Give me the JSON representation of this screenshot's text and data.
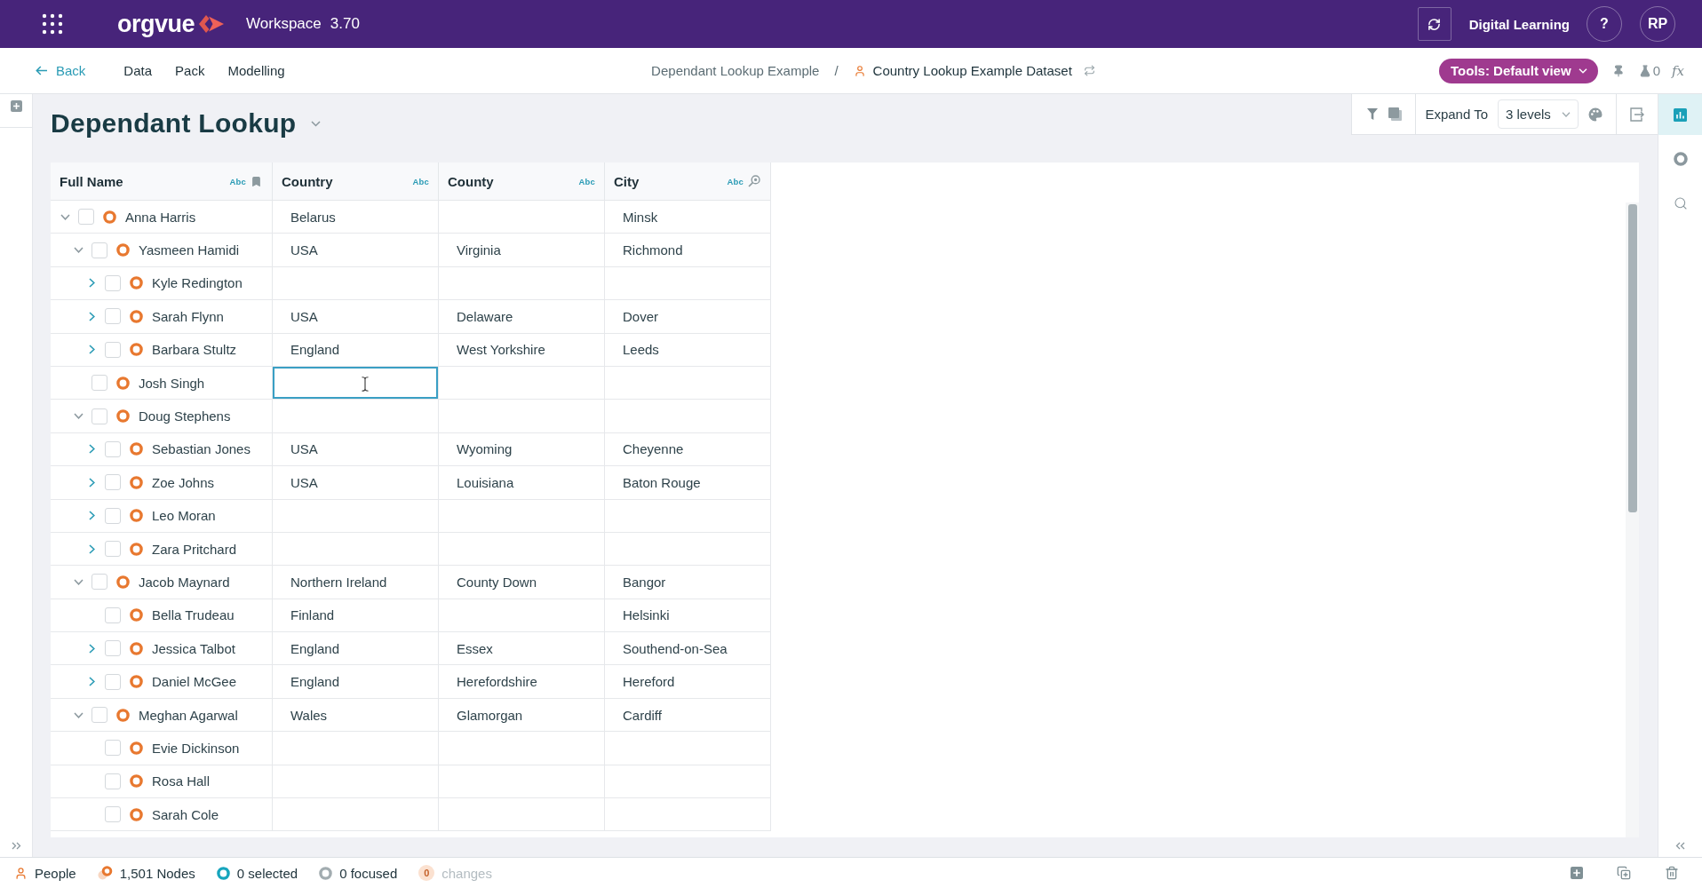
{
  "top_bar": {
    "brand": "orgvue",
    "app_name": "Workspace",
    "version": "3.70",
    "account": "Digital Learning",
    "help": "?",
    "avatar": "RP"
  },
  "nav_bar": {
    "back": "Back",
    "menu": [
      "Data",
      "Pack",
      "Modelling"
    ],
    "breadcrumb": {
      "project": "Dependant Lookup Example",
      "separator": "/",
      "dataset": "Country Lookup Example Dataset"
    },
    "tools_button": "Tools: Default view",
    "flask_count": "0",
    "formula": "fx"
  },
  "page": {
    "title": "Dependant Lookup"
  },
  "toolbar": {
    "expand_label": "Expand To",
    "expand_value": "3 levels"
  },
  "side_tabs": [
    {
      "kind": "chart",
      "selected": true
    },
    {
      "kind": "ring",
      "selected": false
    },
    {
      "kind": "search",
      "selected": false
    }
  ],
  "table": {
    "columns": [
      {
        "label": "Full Name",
        "type_label": "Abc",
        "kind": "key"
      },
      {
        "label": "Country",
        "type_label": "Abc",
        "kind": "text"
      },
      {
        "label": "County",
        "type_label": "Abc",
        "kind": "text"
      },
      {
        "label": "City",
        "type_label": "Abc",
        "kind": "lookup"
      }
    ],
    "rows": [
      {
        "kind": "branch",
        "expanded": true,
        "checked": false,
        "cells": [
          {
            "text": "Anna Harris",
            "selected": false
          },
          {
            "text": "Belarus",
            "selected": false
          },
          {
            "selected": false
          },
          {
            "text": "Minsk",
            "selected": false
          }
        ],
        "children": [
          {
            "kind": "branch",
            "expanded": true,
            "checked": false,
            "cells": [
              {
                "text": "Yasmeen Hamidi",
                "selected": false
              },
              {
                "text": "USA",
                "selected": false
              },
              {
                "text": "Virginia",
                "selected": false
              },
              {
                "text": "Richmond",
                "selected": false
              }
            ],
            "children": [
              {
                "kind": "branch",
                "expanded": false,
                "checked": false,
                "cells": [
                  {
                    "text": "Kyle Redington",
                    "selected": false
                  },
                  {
                    "selected": false
                  },
                  {
                    "selected": false
                  },
                  {
                    "selected": false
                  }
                ]
              },
              {
                "kind": "branch",
                "expanded": false,
                "checked": false,
                "cells": [
                  {
                    "text": "Sarah Flynn",
                    "selected": false
                  },
                  {
                    "text": "USA",
                    "selected": false
                  },
                  {
                    "text": "Delaware",
                    "selected": false
                  },
                  {
                    "text": "Dover",
                    "selected": false
                  }
                ]
              },
              {
                "kind": "branch",
                "expanded": false,
                "checked": false,
                "cells": [
                  {
                    "text": "Barbara Stultz",
                    "selected": false
                  },
                  {
                    "text": "England",
                    "selected": false
                  },
                  {
                    "text": "West Yorkshire",
                    "selected": false
                  },
                  {
                    "text": "Leeds",
                    "selected": false
                  }
                ]
              }
            ]
          },
          {
            "kind": "leaf",
            "checked": false,
            "cells": [
              {
                "text": "Josh Singh",
                "selected": false
              },
              {
                "selected": true
              },
              {
                "selected": false
              },
              {
                "selected": false
              }
            ]
          },
          {
            "kind": "branch",
            "expanded": true,
            "checked": false,
            "cells": [
              {
                "text": "Doug Stephens",
                "selected": false
              },
              {
                "selected": false
              },
              {
                "selected": false
              },
              {
                "selected": false
              }
            ],
            "children": [
              {
                "kind": "branch",
                "expanded": false,
                "checked": false,
                "cells": [
                  {
                    "text": "Sebastian Jones",
                    "selected": false
                  },
                  {
                    "text": "USA",
                    "selected": false
                  },
                  {
                    "text": "Wyoming",
                    "selected": false
                  },
                  {
                    "text": "Cheyenne",
                    "selected": false
                  }
                ]
              },
              {
                "kind": "branch",
                "expanded": false,
                "checked": false,
                "cells": [
                  {
                    "text": "Zoe Johns",
                    "selected": false
                  },
                  {
                    "text": "USA",
                    "selected": false
                  },
                  {
                    "text": "Louisiana",
                    "selected": false
                  },
                  {
                    "text": "Baton Rouge",
                    "selected": false
                  }
                ]
              },
              {
                "kind": "branch",
                "expanded": false,
                "checked": false,
                "cells": [
                  {
                    "text": "Leo Moran",
                    "selected": false
                  },
                  {
                    "selected": false
                  },
                  {
                    "selected": false
                  },
                  {
                    "selected": false
                  }
                ]
              },
              {
                "kind": "branch",
                "expanded": false,
                "checked": false,
                "cells": [
                  {
                    "text": "Zara Pritchard",
                    "selected": false
                  },
                  {
                    "selected": false
                  },
                  {
                    "selected": false
                  },
                  {
                    "selected": false
                  }
                ]
              }
            ]
          },
          {
            "kind": "branch",
            "expanded": true,
            "checked": false,
            "cells": [
              {
                "text": "Jacob Maynard",
                "selected": false
              },
              {
                "text": "Northern Ireland",
                "selected": false
              },
              {
                "text": "County Down",
                "selected": false
              },
              {
                "text": "Bangor",
                "selected": false
              }
            ],
            "children": [
              {
                "kind": "leaf",
                "checked": false,
                "cells": [
                  {
                    "text": "Bella Trudeau",
                    "selected": false
                  },
                  {
                    "text": "Finland",
                    "selected": false
                  },
                  {
                    "selected": false
                  },
                  {
                    "text": "Helsinki",
                    "selected": false
                  }
                ]
              },
              {
                "kind": "branch",
                "expanded": false,
                "checked": false,
                "cells": [
                  {
                    "text": "Jessica Talbot",
                    "selected": false
                  },
                  {
                    "text": "England",
                    "selected": false
                  },
                  {
                    "text": "Essex",
                    "selected": false
                  },
                  {
                    "text": "Southend-on-Sea",
                    "selected": false
                  }
                ]
              },
              {
                "kind": "branch",
                "expanded": false,
                "checked": false,
                "cells": [
                  {
                    "text": "Daniel McGee",
                    "selected": false
                  },
                  {
                    "text": "England",
                    "selected": false
                  },
                  {
                    "text": "Herefordshire",
                    "selected": false
                  },
                  {
                    "text": "Hereford",
                    "selected": false
                  }
                ]
              }
            ]
          },
          {
            "kind": "branch",
            "expanded": true,
            "checked": false,
            "cells": [
              {
                "text": "Meghan Agarwal",
                "selected": false
              },
              {
                "text": "Wales",
                "selected": false
              },
              {
                "text": "Glamorgan",
                "selected": false
              },
              {
                "text": "Cardiff",
                "selected": false
              }
            ],
            "children": [
              {
                "kind": "leaf",
                "checked": false,
                "cells": [
                  {
                    "text": "Evie Dickinson",
                    "selected": false
                  },
                  {
                    "selected": false
                  },
                  {
                    "selected": false
                  },
                  {
                    "selected": false
                  }
                ]
              },
              {
                "kind": "leaf",
                "checked": false,
                "cells": [
                  {
                    "text": "Rosa Hall",
                    "selected": false
                  },
                  {
                    "selected": false
                  },
                  {
                    "selected": false
                  },
                  {
                    "selected": false
                  }
                ]
              },
              {
                "kind": "leaf",
                "checked": false,
                "cells": [
                  {
                    "text": "Sarah Cole",
                    "selected": false
                  },
                  {
                    "selected": false
                  },
                  {
                    "selected": false
                  },
                  {
                    "selected": false
                  }
                ]
              }
            ]
          }
        ]
      }
    ]
  },
  "status_bar": {
    "dataset": "People",
    "nodes": "1,501 Nodes",
    "selected": "0 selected",
    "focused": "0 focused",
    "changes": {
      "count": "0",
      "label": "changes",
      "disabled": true
    }
  }
}
